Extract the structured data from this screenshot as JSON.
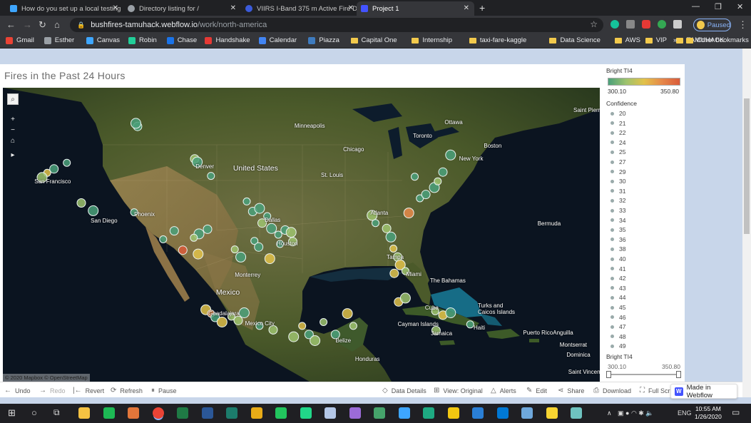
{
  "browser": {
    "tabs": [
      {
        "title": "How do you set up a local testing",
        "icon_color": "#3ea6ff",
        "active": false
      },
      {
        "title": "Directory listing for /",
        "icon_color": "#9aa0a6",
        "active": false
      },
      {
        "title": "VIIRS I-Band 375 m Active Fire D",
        "icon_color": "#3b5bdb",
        "active": false
      },
      {
        "title": "Project 1",
        "icon_color": "#4353ff",
        "active": true
      }
    ],
    "close_glyph": "✕",
    "new_tab": "+",
    "window_controls": [
      "—",
      "❐",
      "✕"
    ],
    "url_host": "bushfires-tamuhack.webflow.io",
    "url_path": "/work/north-america",
    "profile_status": "Paused",
    "bookmarks": [
      {
        "label": "Gmail",
        "icon": "gmail-icon",
        "color": "#ea4335",
        "type": "site"
      },
      {
        "label": "Esther",
        "icon": "esther-icon",
        "color": "#9aa0a6",
        "type": "site"
      },
      {
        "label": "Canvas",
        "icon": "canvas-icon",
        "color": "#3ea6ff",
        "type": "site"
      },
      {
        "label": "Robin",
        "icon": "robin-icon",
        "color": "#21ce99",
        "type": "site"
      },
      {
        "label": "Chase",
        "icon": "chase-icon",
        "color": "#1a73e8",
        "type": "site"
      },
      {
        "label": "Handshake",
        "icon": "handshake-icon",
        "color": "#e53935",
        "type": "site"
      },
      {
        "label": "Calendar",
        "icon": "calendar-icon",
        "color": "#4285f4",
        "type": "site"
      },
      {
        "label": "Piazza",
        "icon": "piazza-icon",
        "color": "#3e7bbf",
        "type": "site"
      },
      {
        "label": "Capital One",
        "icon": "folder-icon",
        "color": "#f2c94c",
        "type": "folder"
      },
      {
        "label": "Internship",
        "icon": "folder-icon",
        "color": "#f2c94c",
        "type": "folder"
      },
      {
        "label": "taxi-fare-kaggle",
        "icon": "folder-icon",
        "color": "#f2c94c",
        "type": "folder"
      },
      {
        "label": "Data Science",
        "icon": "folder-icon",
        "color": "#f2c94c",
        "type": "folder"
      },
      {
        "label": "AWS",
        "icon": "folder-icon",
        "color": "#f2c94c",
        "type": "folder"
      },
      {
        "label": "VIP",
        "icon": "folder-icon",
        "color": "#f2c94c",
        "type": "folder"
      },
      {
        "label": "TAMUHACK",
        "icon": "folder-icon",
        "color": "#f2c94c",
        "type": "folder"
      }
    ],
    "overflow": "»",
    "other_bookmarks": "Other bookmarks"
  },
  "viz": {
    "title": "Fires in the Past 24 Hours",
    "map_labels": [
      "Minneapolis",
      "Ottawa",
      "Toronto",
      "Boston",
      "Chicago",
      "New York",
      "United States",
      "Denver",
      "St. Louis",
      "San Francisco",
      "Atlanta",
      "San Diego",
      "Phoenix",
      "Dallas",
      "Houston",
      "Bermuda",
      "Tampa",
      "Miami",
      "The Bahamas",
      "Monterrey",
      "Mexico",
      "Guadalajara",
      "Mexico City",
      "Cuba",
      "Turks and Caicos Islands",
      "Haiti",
      "Puerto Rico",
      "Anguilla",
      "Cayman Islands",
      "Jamaica",
      "Belize",
      "Montserrat",
      "Dominica",
      "Honduras",
      "Saint Vincent",
      "Saint Pierre and M"
    ],
    "attribution": "© 2020 Mapbox © OpenStreetMap",
    "legend": {
      "bright_ti4_title": "Bright TI4",
      "bright_ti4_min": "300.10",
      "bright_ti4_max": "350.80",
      "confidence_title": "Confidence",
      "confidence_values": [
        "20",
        "21",
        "22",
        "24",
        "25",
        "27",
        "29",
        "30",
        "31",
        "32",
        "33",
        "34",
        "35",
        "36",
        "38",
        "40",
        "41",
        "42",
        "43",
        "44",
        "45",
        "46",
        "47",
        "48",
        "49"
      ],
      "filter_title": "Bright TI4",
      "filter_min": "300.10",
      "filter_max": "350.80"
    },
    "fires": [
      {
        "lon": -122.3,
        "lat": 38.5,
        "color": "#e2c24a"
      },
      {
        "lon": -121.5,
        "lat": 39.0,
        "color": "#4aa07a"
      },
      {
        "lon": -122.9,
        "lat": 37.9,
        "color": "#9ec36e"
      },
      {
        "lon": -120.0,
        "lat": 39.8,
        "color": "#4aa07a"
      },
      {
        "lon": -118.3,
        "lat": 34.6,
        "color": "#9ec36e"
      },
      {
        "lon": -116.9,
        "lat": 33.6,
        "color": "#4aa07a"
      },
      {
        "lon": -112.1,
        "lat": 33.4,
        "color": "#4aa07a"
      },
      {
        "lon": -105.0,
        "lat": 40.3,
        "color": "#9ec36e"
      },
      {
        "lon": -104.7,
        "lat": 39.9,
        "color": "#4aa07a"
      },
      {
        "lon": -103.1,
        "lat": 38.1,
        "color": "#4aa07a"
      },
      {
        "lon": -111.7,
        "lat": 44.5,
        "color": "#4aa07a"
      },
      {
        "lon": -111.9,
        "lat": 44.9,
        "color": "#4aa07a"
      },
      {
        "lon": -98.9,
        "lat": 34.8,
        "color": "#4aa07a"
      },
      {
        "lon": -98.2,
        "lat": 33.5,
        "color": "#4aa07a"
      },
      {
        "lon": -97.4,
        "lat": 33.9,
        "color": "#4aa07a"
      },
      {
        "lon": -96.5,
        "lat": 32.9,
        "color": "#4aa07a"
      },
      {
        "lon": -97.1,
        "lat": 32.0,
        "color": "#9ec36e"
      },
      {
        "lon": -96.0,
        "lat": 31.3,
        "color": "#4aa07a"
      },
      {
        "lon": -95.2,
        "lat": 30.5,
        "color": "#4aa07a"
      },
      {
        "lon": -94.4,
        "lat": 31.1,
        "color": "#4aa07a"
      },
      {
        "lon": -93.7,
        "lat": 30.8,
        "color": "#9ec36e"
      },
      {
        "lon": -98.0,
        "lat": 29.7,
        "color": "#4aa07a"
      },
      {
        "lon": -97.5,
        "lat": 28.9,
        "color": "#4aa07a"
      },
      {
        "lon": -99.6,
        "lat": 27.6,
        "color": "#4aa07a"
      },
      {
        "lon": -100.3,
        "lat": 28.6,
        "color": "#9ec36e"
      },
      {
        "lon": -103.5,
        "lat": 31.2,
        "color": "#4aa07a"
      },
      {
        "lon": -104.5,
        "lat": 30.6,
        "color": "#4aa07a"
      },
      {
        "lon": -105.1,
        "lat": 30.1,
        "color": "#9ec36e"
      },
      {
        "lon": -106.4,
        "lat": 28.5,
        "color": "#d95b3a"
      },
      {
        "lon": -104.6,
        "lat": 28.0,
        "color": "#e2c24a"
      },
      {
        "lon": -108.7,
        "lat": 29.9,
        "color": "#4aa07a"
      },
      {
        "lon": -107.4,
        "lat": 31.0,
        "color": "#4aa07a"
      },
      {
        "lon": -96.2,
        "lat": 27.4,
        "color": "#e2c24a"
      },
      {
        "lon": -95.0,
        "lat": 29.3,
        "color": "#4aa07a"
      },
      {
        "lon": -93.5,
        "lat": 29.6,
        "color": "#9ec36e"
      },
      {
        "lon": -84.2,
        "lat": 33.0,
        "color": "#9ec36e"
      },
      {
        "lon": -83.8,
        "lat": 32.0,
        "color": "#4aa07a"
      },
      {
        "lon": -82.5,
        "lat": 31.3,
        "color": "#9ec36e"
      },
      {
        "lon": -82.0,
        "lat": 30.2,
        "color": "#4aa07a"
      },
      {
        "lon": -81.7,
        "lat": 28.7,
        "color": "#e2c24a"
      },
      {
        "lon": -81.2,
        "lat": 27.6,
        "color": "#9ec36e"
      },
      {
        "lon": -80.9,
        "lat": 26.6,
        "color": "#e2c24a"
      },
      {
        "lon": -80.3,
        "lat": 25.8,
        "color": "#9ec36e"
      },
      {
        "lon": -81.6,
        "lat": 25.5,
        "color": "#e2c24a"
      },
      {
        "lon": -79.9,
        "lat": 33.3,
        "color": "#e6894a"
      },
      {
        "lon": -78.6,
        "lat": 35.2,
        "color": "#4aa07a"
      },
      {
        "lon": -77.9,
        "lat": 35.7,
        "color": "#4aa07a"
      },
      {
        "lon": -76.9,
        "lat": 36.6,
        "color": "#4aa07a"
      },
      {
        "lon": -76.5,
        "lat": 37.4,
        "color": "#9ec36e"
      },
      {
        "lon": -75.9,
        "lat": 38.6,
        "color": "#4aa07a"
      },
      {
        "lon": -75.0,
        "lat": 40.8,
        "color": "#4aa07a"
      },
      {
        "lon": -79.2,
        "lat": 38.0,
        "color": "#4aa07a"
      },
      {
        "lon": -81.1,
        "lat": 21.8,
        "color": "#e2c24a"
      },
      {
        "lon": -80.3,
        "lat": 22.3,
        "color": "#9ec36e"
      },
      {
        "lon": -76.8,
        "lat": 20.6,
        "color": "#9ec36e"
      },
      {
        "lon": -75.9,
        "lat": 20.1,
        "color": "#e2c24a"
      },
      {
        "lon": -75.0,
        "lat": 20.4,
        "color": "#4aa07a"
      },
      {
        "lon": -72.7,
        "lat": 18.9,
        "color": "#4aa07a"
      },
      {
        "lon": -76.7,
        "lat": 18.1,
        "color": "#9ec36e"
      },
      {
        "lon": -103.7,
        "lat": 20.8,
        "color": "#e2c24a"
      },
      {
        "lon": -103.1,
        "lat": 20.3,
        "color": "#e6894a"
      },
      {
        "lon": -102.6,
        "lat": 19.8,
        "color": "#4aa07a"
      },
      {
        "lon": -101.8,
        "lat": 19.2,
        "color": "#e2c24a"
      },
      {
        "lon": -100.7,
        "lat": 19.9,
        "color": "#9ec36e"
      },
      {
        "lon": -99.9,
        "lat": 19.4,
        "color": "#9ec36e"
      },
      {
        "lon": -99.2,
        "lat": 20.4,
        "color": "#4aa07a"
      },
      {
        "lon": -97.4,
        "lat": 18.7,
        "color": "#4aa07a"
      },
      {
        "lon": -95.8,
        "lat": 18.2,
        "color": "#9ec36e"
      },
      {
        "lon": -93.4,
        "lat": 17.3,
        "color": "#9ec36e"
      },
      {
        "lon": -92.4,
        "lat": 18.7,
        "color": "#e2c24a"
      },
      {
        "lon": -91.6,
        "lat": 17.6,
        "color": "#4aa07a"
      },
      {
        "lon": -90.9,
        "lat": 16.8,
        "color": "#9ec36e"
      },
      {
        "lon": -89.9,
        "lat": 19.2,
        "color": "#9ec36e"
      },
      {
        "lon": -88.5,
        "lat": 17.6,
        "color": "#4aa07a"
      },
      {
        "lon": -87.1,
        "lat": 20.3,
        "color": "#e2c24a"
      },
      {
        "lon": -86.4,
        "lat": 18.7,
        "color": "#9ec36e"
      }
    ]
  },
  "toolbar": {
    "undo": "Undo",
    "redo": "Redo",
    "revert": "Revert",
    "refresh": "Refresh",
    "pause": "Pause",
    "data_details": "Data Details",
    "view_original": "View: Original",
    "alerts": "Alerts",
    "edit": "Edit",
    "share": "Share",
    "download": "Download",
    "full_screen": "Full Scr",
    "made_in_webflow": "Made in Webflow"
  },
  "taskbar": {
    "language": "ENG",
    "time": "10:55 AM",
    "date": "1/26/2020",
    "apps": [
      {
        "name": "explorer",
        "color": "#f5c242"
      },
      {
        "name": "spotify",
        "color": "#1db954"
      },
      {
        "name": "matlab",
        "color": "#e2763a"
      },
      {
        "name": "chrome",
        "color": "#ea4335"
      },
      {
        "name": "excel",
        "color": "#1f7a45"
      },
      {
        "name": "word",
        "color": "#2b5797"
      },
      {
        "name": "publisher",
        "color": "#1c7c6c"
      },
      {
        "name": "tableau",
        "color": "#e8ab17"
      },
      {
        "name": "datagrip",
        "color": "#22c55e"
      },
      {
        "name": "pycharm",
        "color": "#21d789"
      },
      {
        "name": "octopus",
        "color": "#b4c7e7"
      },
      {
        "name": "github",
        "color": "#9b6bd8"
      },
      {
        "name": "app-a",
        "color": "#46a36b"
      },
      {
        "name": "app-b",
        "color": "#3ea6ff"
      },
      {
        "name": "app-c",
        "color": "#1eaa82"
      },
      {
        "name": "powerbi",
        "color": "#f2c811"
      },
      {
        "name": "app-d",
        "color": "#2a7fd6"
      },
      {
        "name": "app-e",
        "color": "#0078d4"
      },
      {
        "name": "rstudio",
        "color": "#6fa8dc"
      },
      {
        "name": "sticky",
        "color": "#f7d431"
      },
      {
        "name": "app-f",
        "color": "#6fc3c0"
      }
    ]
  }
}
